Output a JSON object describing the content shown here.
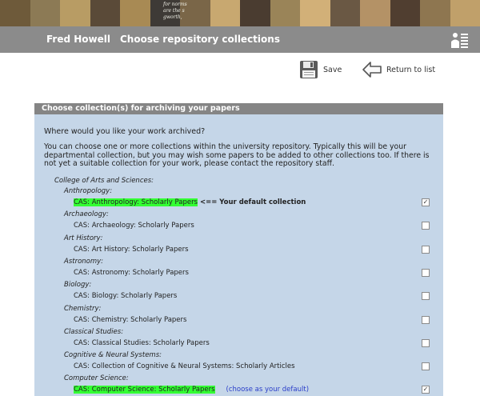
{
  "banner": {
    "tiles": [
      "#6e5a3a",
      "#8c7a55",
      "#b89c64",
      "#5a4a38",
      "#a88a54",
      "#3e3a36",
      "#7a6648",
      "#c8a870",
      "#4a3c30",
      "#9a8458",
      "#d2b078",
      "#6a5844",
      "#b49266",
      "#503e30",
      "#8e7650",
      "#c0a06a"
    ],
    "caption_lines": [
      "for norms",
      "are the s",
      "gworth, "
    ]
  },
  "header": {
    "user": "Fred Howell",
    "title": "Choose repository collections"
  },
  "toolbar": {
    "save_label": "Save",
    "return_label": "Return to list"
  },
  "panel": {
    "title": "Choose collection(s) for archiving your papers",
    "question": "Where would you like your work archived?",
    "intro": "You can choose one or more collections within the university repository. Typically this will be your departmental collection, but you may wish some papers to be added to other collections too. If there is not yet a suitable collection for your work, please contact the repository staff.",
    "college": "College of Arts and Sciences:",
    "default_note": "<== Your default collection",
    "choose_default": "(choose as your default)"
  },
  "departments": [
    {
      "name": "Anthropology:",
      "collection": "CAS: Anthropology: Scholarly Papers",
      "checked": true,
      "highlight": true,
      "is_default": true
    },
    {
      "name": "Archaeology:",
      "collection": "CAS: Archaeology: Scholarly Papers",
      "checked": false
    },
    {
      "name": "Art History:",
      "collection": "CAS: Art History: Scholarly Papers",
      "checked": false
    },
    {
      "name": "Astronomy:",
      "collection": "CAS: Astronomy: Scholarly Papers",
      "checked": false
    },
    {
      "name": "Biology:",
      "collection": "CAS: Biology: Scholarly Papers",
      "checked": false
    },
    {
      "name": "Chemistry:",
      "collection": "CAS: Chemistry: Scholarly Papers",
      "checked": false
    },
    {
      "name": "Classical Studies:",
      "collection": "CAS: Classical Studies: Scholarly Papers",
      "checked": false
    },
    {
      "name": "Cognitive & Neural Systems:",
      "collection": "CAS: Collection of Cognitive & Neural Systems: Scholarly Articles",
      "checked": false
    },
    {
      "name": "Computer Science:",
      "collection": "CAS: Computer Science: Scholarly Papers",
      "checked": true,
      "highlight": true,
      "choose_default": true
    }
  ],
  "colors": {
    "panel_bg": "#c5d6e8",
    "header_bg": "#858585",
    "highlight": "#33ff33",
    "link": "#2a3ec9"
  }
}
